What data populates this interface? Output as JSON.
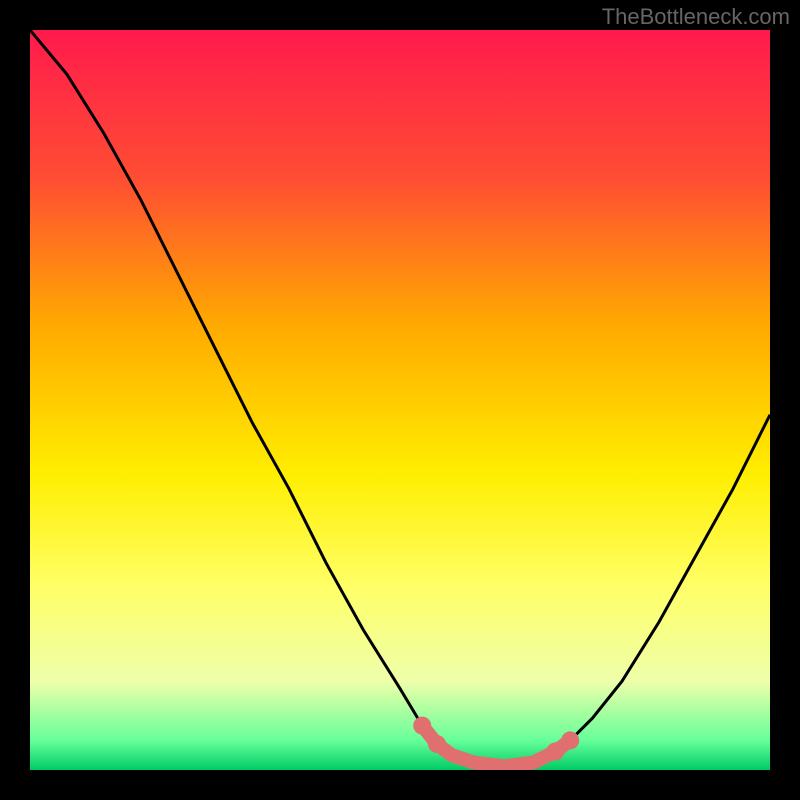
{
  "watermark": "TheBottleneck.com",
  "chart_data": {
    "type": "line",
    "title": "",
    "xlabel": "",
    "ylabel": "",
    "xlim": [
      0,
      100
    ],
    "ylim": [
      0,
      100
    ],
    "gradient_stops": [
      {
        "offset": 0,
        "color": "#ff1a4d"
      },
      {
        "offset": 20,
        "color": "#ff4d33"
      },
      {
        "offset": 40,
        "color": "#ffaa00"
      },
      {
        "offset": 60,
        "color": "#ffee00"
      },
      {
        "offset": 75,
        "color": "#ffff66"
      },
      {
        "offset": 88,
        "color": "#eeffaa"
      },
      {
        "offset": 96,
        "color": "#66ff99"
      },
      {
        "offset": 100,
        "color": "#00cc66"
      }
    ],
    "curve": [
      {
        "x": 0,
        "y": 100
      },
      {
        "x": 5,
        "y": 94
      },
      {
        "x": 10,
        "y": 86
      },
      {
        "x": 15,
        "y": 77
      },
      {
        "x": 20,
        "y": 67
      },
      {
        "x": 25,
        "y": 57
      },
      {
        "x": 30,
        "y": 47
      },
      {
        "x": 35,
        "y": 38
      },
      {
        "x": 40,
        "y": 28
      },
      {
        "x": 45,
        "y": 19
      },
      {
        "x": 50,
        "y": 11
      },
      {
        "x": 53,
        "y": 6
      },
      {
        "x": 56,
        "y": 3
      },
      {
        "x": 60,
        "y": 1
      },
      {
        "x": 64,
        "y": 0.5
      },
      {
        "x": 68,
        "y": 1
      },
      {
        "x": 72,
        "y": 3
      },
      {
        "x": 76,
        "y": 7
      },
      {
        "x": 80,
        "y": 12
      },
      {
        "x": 85,
        "y": 20
      },
      {
        "x": 90,
        "y": 29
      },
      {
        "x": 95,
        "y": 38
      },
      {
        "x": 100,
        "y": 48
      }
    ],
    "highlight_segment": [
      {
        "x": 53,
        "y": 6
      },
      {
        "x": 55,
        "y": 3.5
      },
      {
        "x": 57,
        "y": 2
      },
      {
        "x": 60,
        "y": 1
      },
      {
        "x": 64,
        "y": 0.5
      },
      {
        "x": 68,
        "y": 1
      },
      {
        "x": 71,
        "y": 2.5
      },
      {
        "x": 73,
        "y": 4
      }
    ],
    "highlight_dots": [
      {
        "x": 53,
        "y": 6
      },
      {
        "x": 55,
        "y": 3.5
      },
      {
        "x": 71,
        "y": 2.5
      },
      {
        "x": 73,
        "y": 4
      }
    ],
    "highlight_color": "#e07070"
  }
}
